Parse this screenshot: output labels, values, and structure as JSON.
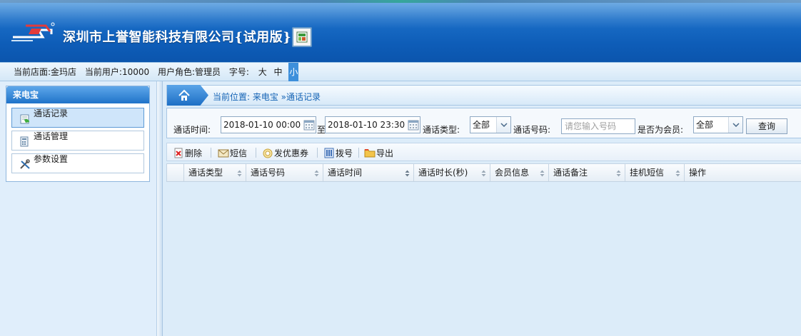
{
  "app": {
    "company_name": "深圳市上誉智能科技有限公司{试用版}"
  },
  "infobar": {
    "store_label": "当前店面:",
    "store_value": "金玛店",
    "user_label": "当前用户:",
    "user_value": "10000",
    "role_label": "用户角色:",
    "role_value": "管理员",
    "font_label": "字号:",
    "font_sizes": [
      "大",
      "中",
      "小"
    ],
    "font_active": "小"
  },
  "sidebar": {
    "title": "来电宝",
    "items": [
      {
        "label": "通话记录",
        "active": true,
        "icon": "phone-record-icon"
      },
      {
        "label": "通话管理",
        "active": false,
        "icon": "phone-manage-icon"
      },
      {
        "label": "参数设置",
        "active": false,
        "icon": "tools-icon"
      }
    ]
  },
  "breadcrumb": {
    "text": "当前位置: 来电宝 »通话记录"
  },
  "search": {
    "time_label": "通话时间:",
    "start": "2018-01-10 00:00",
    "to_label": "至",
    "end": "2018-01-10 23:30",
    "type_label": "通话类型:",
    "type_value": "全部",
    "phone_label": "通话号码:",
    "phone_placeholder": "请您输入号码",
    "member_label": "是否为会员:",
    "member_value": "全部",
    "query_label": "查询"
  },
  "toolbar": {
    "delete_label": "删除",
    "sms_label": "短信",
    "coupon_label": "发优惠券",
    "dial_label": "拨号",
    "export_label": "导出"
  },
  "grid": {
    "columns": [
      "通话类型",
      "通话号码",
      "通话时间",
      "通话时长(秒)",
      "会员信息",
      "通话备注",
      "挂机短信",
      "操作"
    ],
    "rows": []
  },
  "colors": {
    "banner": "#0e5db8",
    "accent": "#1f73c9",
    "link": "#1463b5",
    "panel_bg": "#dcecf9"
  }
}
